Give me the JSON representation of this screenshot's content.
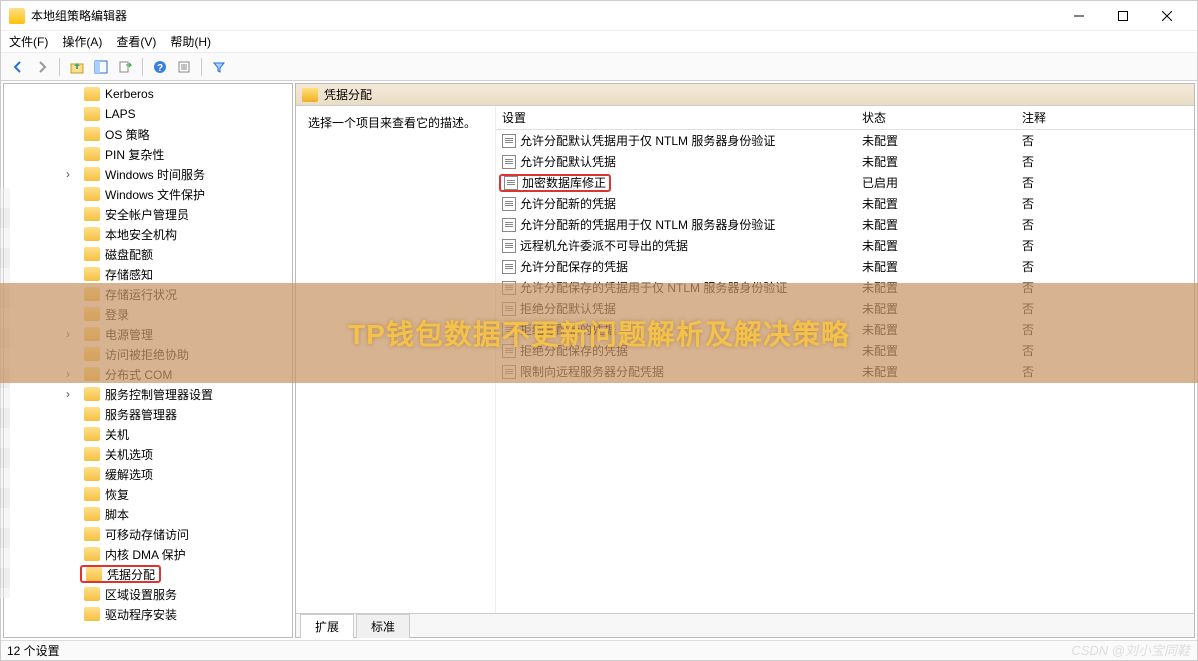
{
  "window": {
    "title": "本地组策略编辑器"
  },
  "menu": {
    "file": "文件(F)",
    "action": "操作(A)",
    "view": "查看(V)",
    "help": "帮助(H)"
  },
  "tree": {
    "items": [
      {
        "label": "Kerberos",
        "children": false
      },
      {
        "label": "LAPS",
        "children": false
      },
      {
        "label": "OS 策略",
        "children": false
      },
      {
        "label": "PIN 复杂性",
        "children": false
      },
      {
        "label": "Windows 时间服务",
        "children": true
      },
      {
        "label": "Windows 文件保护",
        "children": false
      },
      {
        "label": "安全帐户管理员",
        "children": false
      },
      {
        "label": "本地安全机构",
        "children": false
      },
      {
        "label": "磁盘配额",
        "children": false
      },
      {
        "label": "存储感知",
        "children": false
      },
      {
        "label": "存储运行状况",
        "children": false
      },
      {
        "label": "登录",
        "children": false
      },
      {
        "label": "电源管理",
        "children": true
      },
      {
        "label": "访问被拒绝协助",
        "children": false
      },
      {
        "label": "分布式 COM",
        "children": true
      },
      {
        "label": "服务控制管理器设置",
        "children": true
      },
      {
        "label": "服务器管理器",
        "children": false
      },
      {
        "label": "关机",
        "children": false
      },
      {
        "label": "关机选项",
        "children": false
      },
      {
        "label": "缓解选项",
        "children": false
      },
      {
        "label": "恢复",
        "children": false
      },
      {
        "label": "脚本",
        "children": false
      },
      {
        "label": "可移动存储访问",
        "children": false
      },
      {
        "label": "内核 DMA 保护",
        "children": false
      },
      {
        "label": "凭据分配",
        "children": false,
        "selected": true
      },
      {
        "label": "区域设置服务",
        "children": false
      },
      {
        "label": "驱动程序安装",
        "children": false
      }
    ]
  },
  "right": {
    "header_title": "凭据分配",
    "description_prompt": "选择一个项目来查看它的描述。",
    "columns": {
      "setting": "设置",
      "state": "状态",
      "note": "注释"
    },
    "rows": [
      {
        "label": "允许分配默认凭据用于仅 NTLM 服务器身份验证",
        "state": "未配置",
        "note": "否"
      },
      {
        "label": "允许分配默认凭据",
        "state": "未配置",
        "note": "否"
      },
      {
        "label": "加密数据库修正",
        "state": "已启用",
        "note": "否",
        "highlighted": true
      },
      {
        "label": "允许分配新的凭据",
        "state": "未配置",
        "note": "否"
      },
      {
        "label": "允许分配新的凭据用于仅 NTLM 服务器身份验证",
        "state": "未配置",
        "note": "否"
      },
      {
        "label": "远程机允许委派不可导出的凭据",
        "state": "未配置",
        "note": "否"
      },
      {
        "label": "允许分配保存的凭据",
        "state": "未配置",
        "note": "否"
      },
      {
        "label": "允许分配保存的凭据用于仅 NTLM 服务器身份验证",
        "state": "未配置",
        "note": "否"
      },
      {
        "label": "拒绝分配默认凭据",
        "state": "未配置",
        "note": "否"
      },
      {
        "label": "拒绝分配新的凭据",
        "state": "未配置",
        "note": "否"
      },
      {
        "label": "拒绝分配保存的凭据",
        "state": "未配置",
        "note": "否"
      },
      {
        "label": "限制向远程服务器分配凭据",
        "state": "未配置",
        "note": "否"
      }
    ],
    "tabs": {
      "extended": "扩展",
      "standard": "标准"
    }
  },
  "status": {
    "text": "12 个设置"
  },
  "overlay": {
    "text": "TP钱包数据不更新问题解析及解决策略"
  },
  "watermark": {
    "text": "CSDN @刘小宝同鞋"
  }
}
